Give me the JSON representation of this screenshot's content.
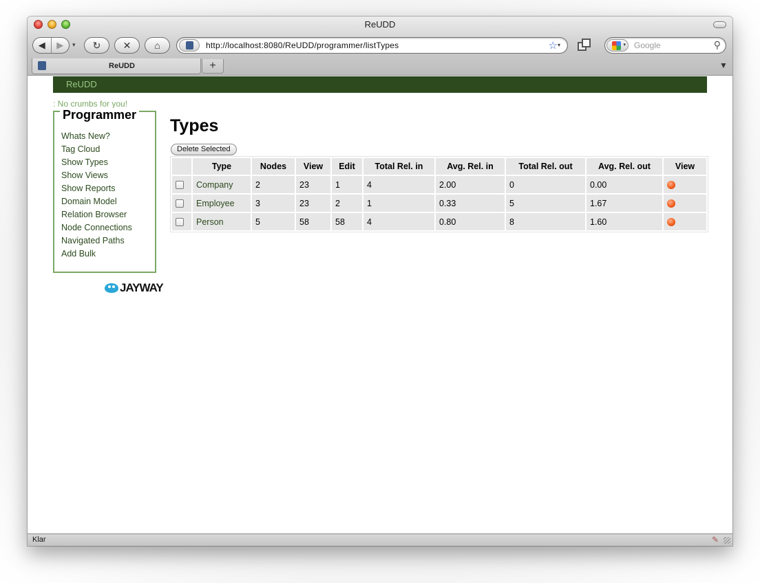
{
  "window": {
    "title": "ReUDD"
  },
  "toolbar": {
    "back_glyph": "◀",
    "forward_glyph": "▶",
    "dropdown_glyph": "▾",
    "reload_glyph": "↻",
    "stop_glyph": "✕",
    "home_glyph": "⌂",
    "url": "http://localhost:8080/ReUDD/programmer/listTypes",
    "bookmark_glyph": "☆",
    "bookmark_drop_glyph": "▾",
    "search_placeholder": "Google",
    "search_glyph": "⚲"
  },
  "tabs": [
    {
      "label": "ReUDD"
    }
  ],
  "newtab_glyph": "+",
  "tablist_glyph": "▼",
  "site": {
    "brand": "ReUDD",
    "crumbs": ": No crumbs for you!",
    "sidebar": {
      "title": "Programmer",
      "items": [
        "Whats New?",
        "Tag Cloud",
        "Show Types",
        "Show Views",
        "Show Reports",
        "Domain Model",
        "Relation Browser",
        "Node Connections",
        "Navigated Paths",
        "Add Bulk"
      ]
    },
    "logo_text": "JAYWAY"
  },
  "main": {
    "heading": "Types",
    "delete_button": "Delete Selected",
    "columns": [
      "",
      "Type",
      "Nodes",
      "View",
      "Edit",
      "Total Rel. in",
      "Avg. Rel. in",
      "Total Rel. out",
      "Avg. Rel. out",
      "View"
    ],
    "rows": [
      {
        "type": "Company",
        "nodes": "2",
        "view": "23",
        "edit": "1",
        "total_in": "4",
        "avg_in": "2.00",
        "total_out": "0",
        "avg_out": "0.00"
      },
      {
        "type": "Employee",
        "nodes": "3",
        "view": "23",
        "edit": "2",
        "total_in": "1",
        "avg_in": "0.33",
        "total_out": "5",
        "avg_out": "1.67"
      },
      {
        "type": "Person",
        "nodes": "5",
        "view": "58",
        "edit": "58",
        "total_in": "4",
        "avg_in": "0.80",
        "total_out": "8",
        "avg_out": "1.60"
      }
    ]
  },
  "status": {
    "text": "Klar"
  },
  "colors": {
    "banner": "#2c4a1e",
    "brand_text": "#9bc683",
    "sidebar_border": "#7aa864",
    "link": "#2c4a1e",
    "view_dot": "#f05a1a"
  }
}
